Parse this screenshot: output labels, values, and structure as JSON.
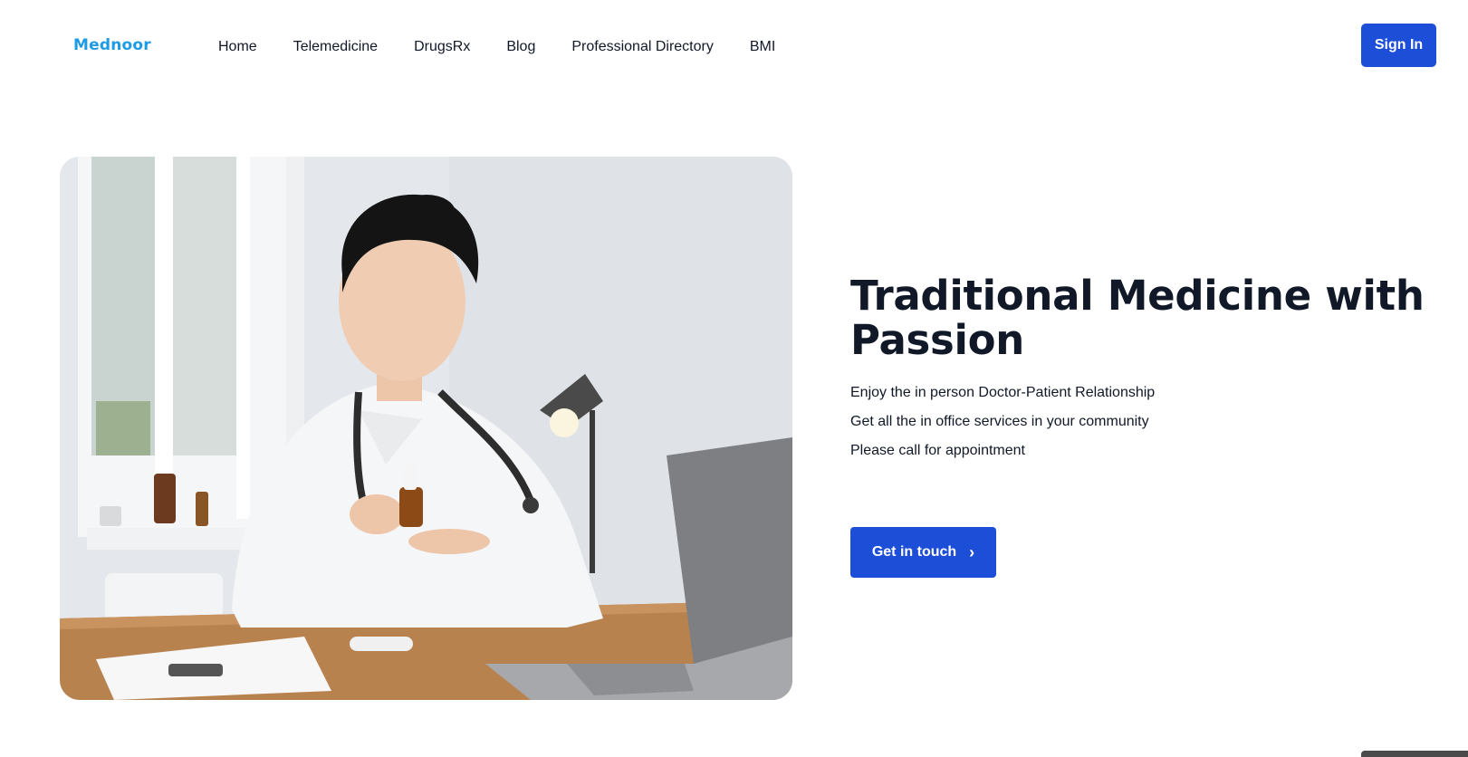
{
  "header": {
    "logo": "Mednoor",
    "nav": [
      "Home",
      "Telemedicine",
      "DrugsRx",
      "Blog",
      "Professional Directory",
      "BMI"
    ],
    "signin_label": "Sign In"
  },
  "hero": {
    "title": "Traditional Medicine with Passion",
    "lines": [
      "Enjoy the in person Doctor-Patient Relationship",
      "Get all the in office services in your community",
      "Please call for appointment"
    ],
    "cta_label": "Get in touch",
    "cta_icon": "chevron-right-icon"
  },
  "colors": {
    "brand": "#1e9be5",
    "primary_button": "#1d4ed8",
    "text": "#111827"
  }
}
